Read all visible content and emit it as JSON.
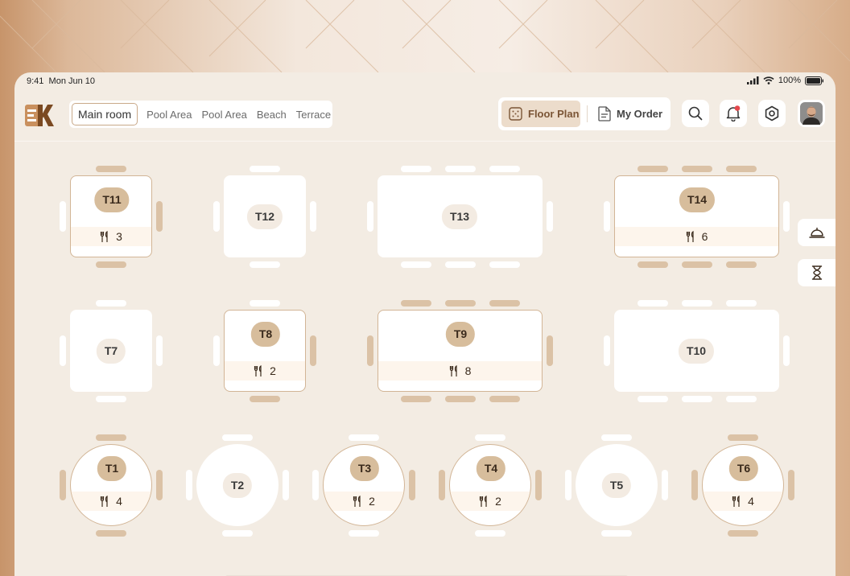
{
  "status_bar": {
    "time": "9:41",
    "date": "Mon Jun 10",
    "battery": "100%"
  },
  "rooms": {
    "items": [
      "Main room",
      "Pool Area",
      "Pool Area",
      "Beach",
      "Terrace"
    ],
    "active_index": 0
  },
  "view_toggle": {
    "floor_plan": "Floor Plan",
    "my_order": "My Order",
    "active": "Floor Plan"
  },
  "header_icons": [
    "search-icon",
    "bell-icon",
    "settings-icon"
  ],
  "notification_dot": true,
  "side_buttons": [
    "bell-service-icon",
    "hourglass-icon"
  ],
  "tables": [
    {
      "id": "T11",
      "shape": "square",
      "occupied": true,
      "guests": "3"
    },
    {
      "id": "T12",
      "shape": "square",
      "occupied": false
    },
    {
      "id": "T13",
      "shape": "rect",
      "occupied": false
    },
    {
      "id": "T14",
      "shape": "rect",
      "occupied": true,
      "guests": "6"
    },
    {
      "id": "T7",
      "shape": "square",
      "occupied": false
    },
    {
      "id": "T8",
      "shape": "square",
      "occupied": true,
      "guests": "2"
    },
    {
      "id": "T9",
      "shape": "rect",
      "occupied": true,
      "guests": "8"
    },
    {
      "id": "T10",
      "shape": "rect",
      "occupied": false
    },
    {
      "id": "T1",
      "shape": "round",
      "occupied": true,
      "guests": "4"
    },
    {
      "id": "T2",
      "shape": "round",
      "occupied": false
    },
    {
      "id": "T3",
      "shape": "round",
      "occupied": true,
      "guests": "2"
    },
    {
      "id": "T4",
      "shape": "round",
      "occupied": true,
      "guests": "2"
    },
    {
      "id": "T5",
      "shape": "round",
      "occupied": false
    },
    {
      "id": "T6",
      "shape": "round",
      "occupied": true,
      "guests": "4"
    }
  ],
  "colors": {
    "accent": "#d7bd9c",
    "accent_border": "#d2b596",
    "occupied_strip": "#fdf5ec",
    "background": "#f3ece3",
    "notification": "#e5484d"
  }
}
